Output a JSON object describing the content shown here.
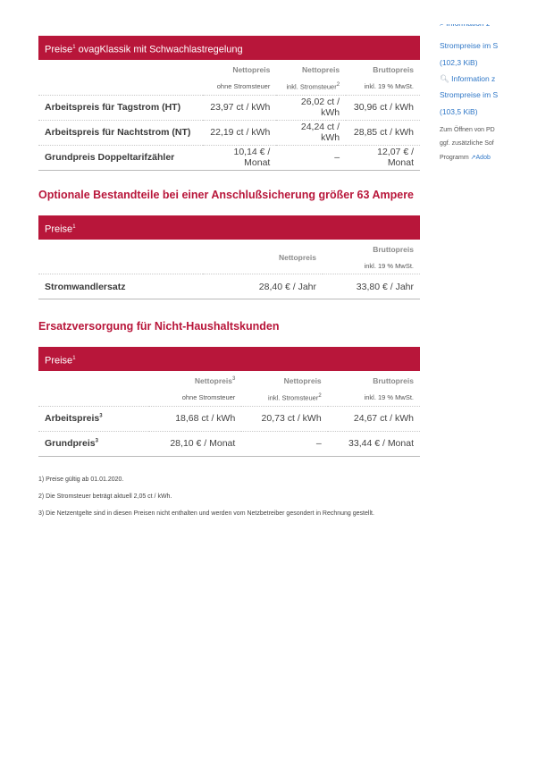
{
  "table1": {
    "header": "Preise",
    "header_sup": "1",
    "header_rest": "ovagKlassik mit Schwachlastregelung",
    "columns": [
      {
        "name": "Nettopreis",
        "sup": "",
        "sub": "ohne Stromsteuer",
        "sub_sup": ""
      },
      {
        "name": "Nettopreis",
        "sup": "",
        "sub": "inkl. Stromsteuer",
        "sub_sup": "2"
      },
      {
        "name": "Bruttopreis",
        "sup": "",
        "sub": "inkl. 19 % MwSt.",
        "sub_sup": ""
      }
    ],
    "rows": [
      {
        "label": "Arbeitspreis für Tagstrom (HT)",
        "values": [
          "23,97 ct / kWh",
          "26,02 ct / kWh",
          "30,96 ct / kWh"
        ]
      },
      {
        "label": "Arbeitspreis für Nachtstrom (NT)",
        "values": [
          "22,19 ct / kWh",
          "24,24 ct / kWh",
          "28,85 ct / kWh"
        ]
      },
      {
        "label": "Grundpreis Doppeltarifzähler",
        "values": [
          "10,14 € / Monat",
          "–",
          "12,07 € / Monat"
        ]
      }
    ]
  },
  "section2": {
    "title": "Optionale Bestandteile bei einer Anschlußsicherung größer 63 Ampere",
    "header": "Preise",
    "header_sup": "1",
    "columns": [
      {
        "name": "Nettopreis",
        "sub": ""
      },
      {
        "name": "Bruttopreis",
        "sub": "inkl. 19 % MwSt."
      }
    ],
    "rows": [
      {
        "label": "Stromwandlersatz",
        "values": [
          "28,40 € / Jahr",
          "33,80 € / Jahr"
        ]
      }
    ]
  },
  "section3": {
    "title": "Ersatzversorgung für Nicht-Haushaltskunden",
    "header": "Preise",
    "header_sup": "1",
    "columns": [
      {
        "name": "Nettopreis",
        "sup": "3",
        "sub": "ohne Stromsteuer",
        "sub_sup": ""
      },
      {
        "name": "Nettopreis",
        "sup": "",
        "sub": "inkl. Stromsteuer",
        "sub_sup": "2"
      },
      {
        "name": "Bruttopreis",
        "sup": "",
        "sub": "inkl. 19 % MwSt.",
        "sub_sup": ""
      }
    ],
    "rows": [
      {
        "label": "Arbeitspreis",
        "label_sup": "3",
        "values": [
          "18,68 ct / kWh",
          "20,73 ct / kWh",
          "24,67 ct / kWh"
        ]
      },
      {
        "label": "Grundpreis",
        "label_sup": "3",
        "values": [
          "28,10 € / Monat",
          "–",
          "33,44 € / Monat"
        ]
      }
    ]
  },
  "footnotes": [
    "1) Preise gültig ab 01.01.2020.",
    "2) Die Stromsteuer beträgt aktuell 2,05 ct / kWh.",
    "3) Die Netzentgelte sind in diesen Preisen nicht enthalten und werden vom Netzbetreiber gesondert in Rechnung gestellt."
  ],
  "sidebar": {
    "link1_line1": "Strompreise im S",
    "link1_size": "(102,3 KiB)",
    "link2_line1": "Information z",
    "link2_line2": "Strompreise im S",
    "link2_size": "(103,5 KiB)",
    "note_line1": "Zum Öffnen von PD",
    "note_line2": "ggf. zusätzliche Sof",
    "note_line3": "Programm",
    "note_link": "Adob"
  },
  "colors": {
    "accent": "#b8163a",
    "link": "#2f77c7"
  }
}
